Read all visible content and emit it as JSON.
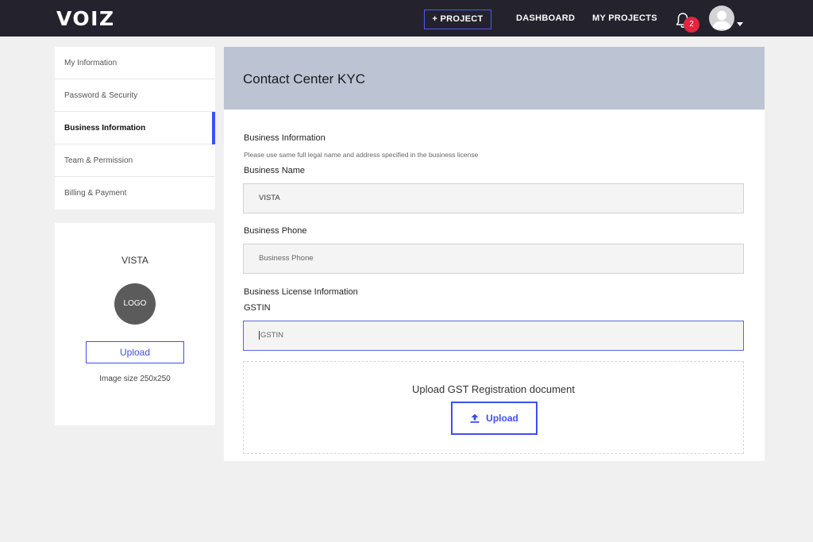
{
  "topbar": {
    "logo": "VOIZ",
    "new_project_label": "+ PROJECT",
    "dashboard_label": "DASHBOARD",
    "my_projects_label": "MY PROJECTS",
    "notification_count": "2"
  },
  "sidebar": {
    "items": [
      {
        "label": "My Information",
        "active": false
      },
      {
        "label": "Password & Security",
        "active": false
      },
      {
        "label": "Business Information",
        "active": true
      },
      {
        "label": "Team & Permission",
        "active": false
      },
      {
        "label": "Billing & Payment",
        "active": false
      }
    ]
  },
  "logo_card": {
    "company_name": "VISTA",
    "logo_placeholder": "LOGO",
    "upload_label": "Upload",
    "image_size_note": "Image size 250x250"
  },
  "main": {
    "title": "Contact Center KYC",
    "section_title": "Business Information",
    "section_note": "Please use same full legal name and address specified in the business license",
    "business_name_label": "Business Name",
    "business_name_value": "VISTA",
    "business_phone_label": "Business Phone",
    "business_phone_placeholder": "Business Phone",
    "license_section_title": "Business License Information",
    "gstin_label": "GSTIN",
    "gstin_placeholder": "GSTIN",
    "upload_prompt": "Upload GST Registration document",
    "upload_label": "Upload"
  },
  "colors": {
    "topbar_bg": "#23222d",
    "accent": "#3d4ff0",
    "badge": "#e5243f",
    "header_bg": "#bcc4d3",
    "page_bg": "#f0f0f0"
  }
}
